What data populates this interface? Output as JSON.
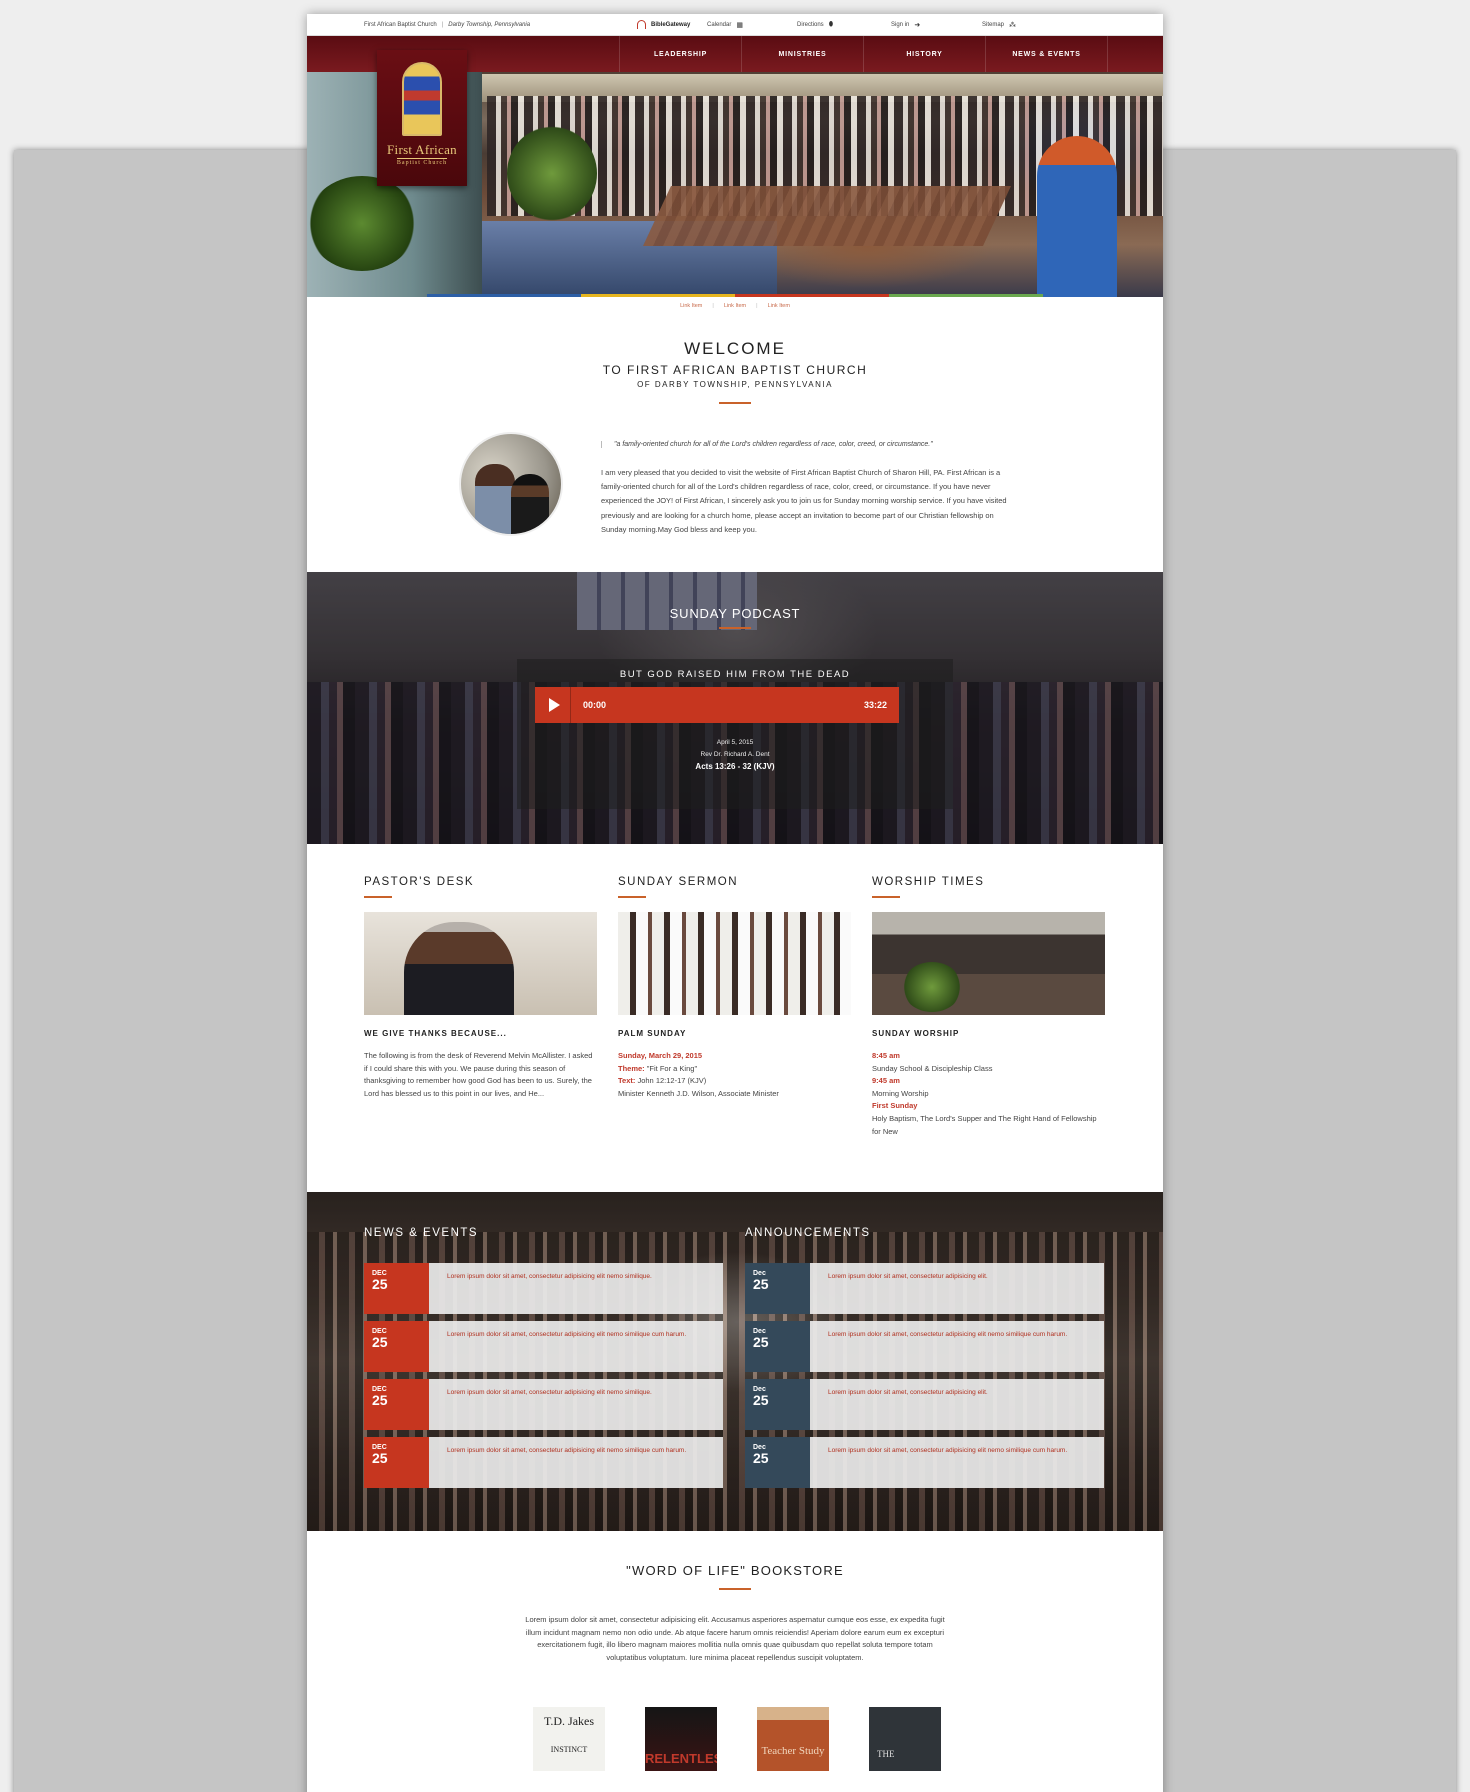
{
  "utility": {
    "church_name": "First African Baptist Church",
    "separator": "|",
    "location": "Darby Township, Pennsylvania",
    "biblegateway": "BibleGateway",
    "calendar": "Calendar",
    "directions": "Directions",
    "signin": "Sign in",
    "sitemap": "Sitemap"
  },
  "nav": [
    "LEADERSHIP",
    "MINISTRIES",
    "HISTORY",
    "NEWS & EVENTS"
  ],
  "logo": {
    "line1": "First African",
    "line2": "Baptist Church"
  },
  "accent_colors": [
    "#2d5fa6",
    "#e6b51e",
    "#c6361f",
    "#6aa84f"
  ],
  "sub_links": [
    "Link Item",
    "Link Item",
    "Link Item"
  ],
  "welcome": {
    "title": "WELCOME",
    "subtitle": "TO FIRST AFRICAN BAPTIST CHURCH",
    "location": "OF DARBY TOWNSHIP, PENNSYLVANIA",
    "quote": "\"a family-oriented church for all of the Lord's children regardless of race, color, creed, or circumstance.\"",
    "body": "I am very pleased that you decided to visit the website of First African Baptist Church of Sharon Hill, PA. First African is a family-oriented church for all of the Lord's children regardless of race, color, creed, or circumstance. If you have never experienced the JOY! of First African, I sincerely ask you to join us for Sunday morning worship service. If you have visited previously and are looking for a church home, please accept an invitation to become part of our Christian fellowship on Sunday morning.May God bless and keep you."
  },
  "podcast": {
    "heading": "SUNDAY PODCAST",
    "sermon_title": "BUT GOD RAISED HIM FROM THE DEAD",
    "current_time": "00:00",
    "duration": "33:22",
    "date": "April 5, 2015",
    "preacher": "Rev Dr. Richard A. Dent",
    "scripture": "Acts 13:26 - 32 (KJV)"
  },
  "pastors_desk": {
    "heading": "PASTOR'S DESK",
    "subheading": "WE GIVE THANKS BECAUSE...",
    "text": "The following is from the desk of Reverend Melvin McAllister. I asked if I could share this with you. We pause during this season of thanksgiving to remember how good God has been to us. Surely, the Lord has blessed us to this point in our lives, and He..."
  },
  "sunday_sermon": {
    "heading": "SUNDAY SERMON",
    "subheading": "PALM SUNDAY",
    "date": "Sunday, March 29, 2015",
    "theme_label": "Theme:",
    "theme": "\"Fit For a King\"",
    "text_label": "Text:",
    "text": "John 12:12-17 (KJV)",
    "minister": "Minister Kenneth J.D. Wilson, Associate Minister"
  },
  "worship_times": {
    "heading": "WORSHIP TIMES",
    "subheading": "SUNDAY WORSHIP",
    "time1": "8:45 am",
    "desc1": "Sunday School & Discipleship Class",
    "time2": "9:45 am",
    "desc2": "Morning Worship",
    "time3": "First Sunday",
    "desc3": "Holy Baptism, The Lord's Supper and The Right Hand of Fellowship for New"
  },
  "news_events": {
    "heading": "NEWS & EVENTS",
    "items": [
      {
        "month": "DEC",
        "day": "25",
        "text": "Lorem ipsum dolor sit amet, consectetur adipisicing elit nemo similique."
      },
      {
        "month": "DEC",
        "day": "25",
        "text": "Lorem ipsum dolor sit amet, consectetur adipisicing elit nemo similique cum harum."
      },
      {
        "month": "DEC",
        "day": "25",
        "text": "Lorem ipsum dolor sit amet, consectetur adipisicing elit nemo similique."
      },
      {
        "month": "DEC",
        "day": "25",
        "text": "Lorem ipsum dolor sit amet, consectetur adipisicing elit nemo similique cum harum."
      }
    ]
  },
  "announcements": {
    "heading": "ANNOUNCEMENTS",
    "items": [
      {
        "month": "Dec",
        "day": "25",
        "text": "Lorem ipsum dolor sit amet, consectetur adipisicing elit."
      },
      {
        "month": "Dec",
        "day": "25",
        "text": "Lorem ipsum dolor sit amet, consectetur adipisicing elit nemo similique cum harum."
      },
      {
        "month": "Dec",
        "day": "25",
        "text": "Lorem ipsum dolor sit amet, consectetur adipisicing elit."
      },
      {
        "month": "Dec",
        "day": "25",
        "text": "Lorem ipsum dolor sit amet, consectetur adipisicing elit nemo similique cum harum."
      }
    ]
  },
  "bookstore": {
    "heading": "\"WORD OF LIFE\" BOOKSTORE",
    "text": "Lorem ipsum dolor sit amet, consectetur adipisicing elit. Accusamus asperiores aspernatur cumque eos esse, ex expedita fugit illum incidunt magnam nemo non odio unde. Ab atque facere harum omnis reiciendis! Aperiam dolore earum eum ex excepturi exercitationem fugit, illo libero magnam maiores mollitia nulla omnis quae quibusdam quo repellat soluta tempore totam voluptatibus voluptatum. Iure minima placeat repellendus suscipit voluptatem.",
    "books": [
      {
        "title": "T.D. Jakes",
        "subtitle": "INSTINCT"
      },
      {
        "title": "RELENTLESS"
      },
      {
        "title": "Teacher Study"
      },
      {
        "title": "THE"
      }
    ]
  }
}
